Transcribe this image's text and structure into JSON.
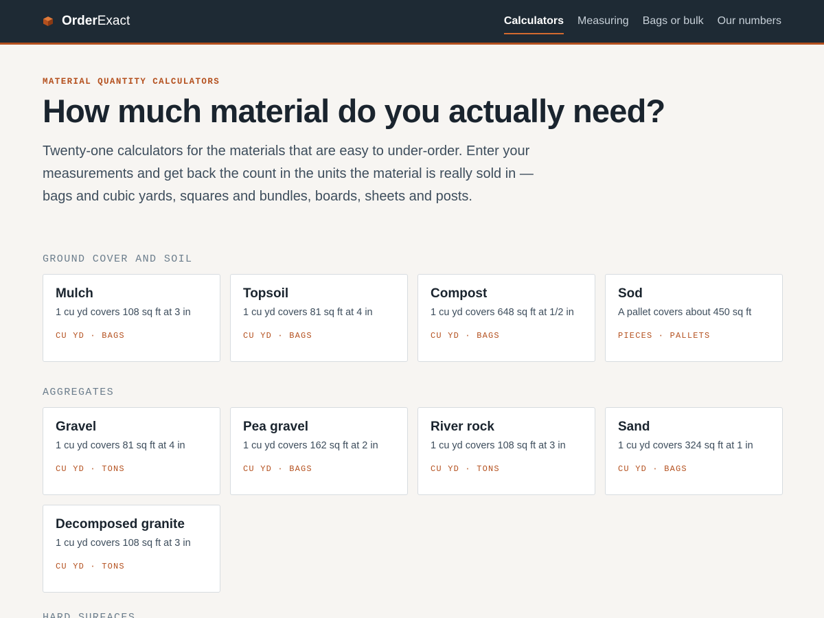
{
  "header": {
    "brand_bold": "Order",
    "brand_light": "Exact",
    "logo_icon": "cube-icon",
    "nav": [
      {
        "label": "Calculators",
        "active": true
      },
      {
        "label": "Measuring",
        "active": false
      },
      {
        "label": "Bags or bulk",
        "active": false
      },
      {
        "label": "Our numbers",
        "active": false
      }
    ]
  },
  "hero": {
    "eyebrow": "MATERIAL QUANTITY CALCULATORS",
    "title": "How much material do you actually need?",
    "intro": "Twenty-one calculators for the materials that are easy to under-order. Enter your measurements and get back the count in the units the material is really sold in — bags and cubic yards, squares and bundles, boards, sheets and posts."
  },
  "sections": [
    {
      "title": "GROUND COVER AND SOIL",
      "cards": [
        {
          "name": "Mulch",
          "desc": "1 cu yd covers 108 sq ft at 3 in",
          "tags": "CU YD · BAGS"
        },
        {
          "name": "Topsoil",
          "desc": "1 cu yd covers 81 sq ft at 4 in",
          "tags": "CU YD · BAGS"
        },
        {
          "name": "Compost",
          "desc": "1 cu yd covers 648 sq ft at 1/2 in",
          "tags": "CU YD · BAGS"
        },
        {
          "name": "Sod",
          "desc": "A pallet covers about 450 sq ft",
          "tags": "PIECES · PALLETS"
        }
      ]
    },
    {
      "title": "AGGREGATES",
      "cards": [
        {
          "name": "Gravel",
          "desc": "1 cu yd covers 81 sq ft at 4 in",
          "tags": "CU YD · TONS"
        },
        {
          "name": "Pea gravel",
          "desc": "1 cu yd covers 162 sq ft at 2 in",
          "tags": "CU YD · BAGS"
        },
        {
          "name": "River rock",
          "desc": "1 cu yd covers 108 sq ft at 3 in",
          "tags": "CU YD · TONS"
        },
        {
          "name": "Sand",
          "desc": "1 cu yd covers 324 sq ft at 1 in",
          "tags": "CU YD · BAGS"
        },
        {
          "name": "Decomposed granite",
          "desc": "1 cu yd covers 108 sq ft at 3 in",
          "tags": "CU YD · TONS"
        }
      ]
    },
    {
      "title": "HARD SURFACES",
      "cards": []
    }
  ],
  "colors": {
    "header_bg": "#1e2a34",
    "accent": "#b4501e",
    "page_bg": "#f7f5f2"
  }
}
